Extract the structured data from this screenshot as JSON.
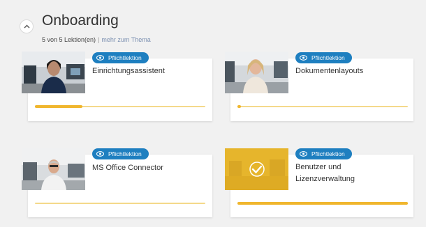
{
  "section": {
    "title": "Onboarding",
    "lessons_count": "5 von 5 Lektion(en)",
    "separator": "|",
    "more_link": "mehr zum Thema"
  },
  "lessons": [
    {
      "badge": "Pflichtlektion",
      "title": "Einrichtungsassistent",
      "progress": 0.28
    },
    {
      "badge": "Pflichtlektion",
      "title": "Dokumentenlayouts",
      "progress": 0.02
    },
    {
      "badge": "Pflichtlektion",
      "title": "MS Office Connector",
      "progress": 0.0
    },
    {
      "badge": "Pflichtlektion",
      "title": "Benutzer und Lizenzverwaltung",
      "progress": 1.0
    }
  ],
  "colors": {
    "badge_bg": "#1e7fc0",
    "progress_fill": "#f0b62e",
    "progress_track": "#f4d98a",
    "completed_overlay": "#e6b52c"
  }
}
